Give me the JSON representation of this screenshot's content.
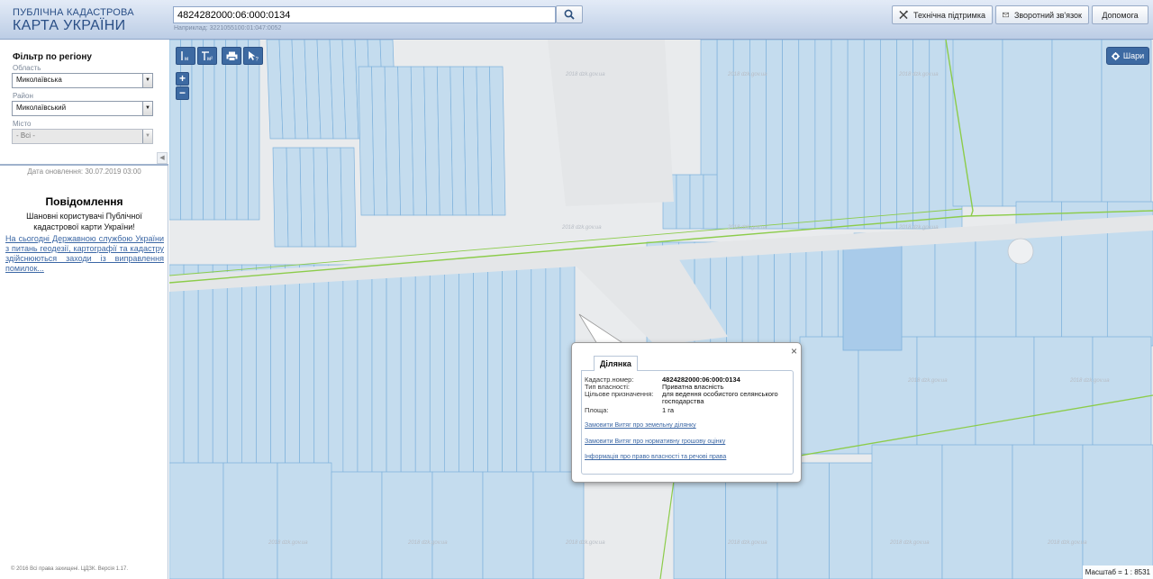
{
  "header": {
    "logo_line1": "ПУБЛІЧНА КАДАСТРОВА",
    "logo_line2": "КАРТА УКРАЇНИ",
    "search_value": "4824282000:06:000:0134",
    "search_hint": "Наприклад: 3221055100:01:047:0052",
    "buttons": {
      "support": "Технічна підтримка",
      "feedback": "Зворотний зв'язок",
      "help": "Допомога"
    }
  },
  "sidebar": {
    "filter_title": "Фільтр по регіону",
    "oblast_label": "Область",
    "oblast_value": "Миколаївська",
    "rayon_label": "Район",
    "rayon_value": "Миколаївський",
    "city_label": "Місто",
    "city_value": "- Всі -",
    "update_date": "Дата оновлення: 30.07.2019 03:00",
    "notice_title": "Повідомлення",
    "notice_text": "Шановні користувачі Публічної кадастрової карти України!",
    "notice_link": "На сьогодні Державною службою України з питань геодезії, картографії та кадастру здійснюються заходи із виправлення помилок...",
    "copyright": "© 2016 Всі права захищені. ЦДЗК. Версія 1.17."
  },
  "map": {
    "layers_label": "Шари",
    "scale_text": "Масштаб = 1 : 8531",
    "watermark": "2018 dzk.gov.ua"
  },
  "popup": {
    "tab_label": "Ділянка",
    "fields": [
      {
        "label": "Кадастр.номер:",
        "value": "4824282000:06:000:0134"
      },
      {
        "label": "Тип власності:",
        "value": "Приватна власність"
      },
      {
        "label": "Цільове призначення:",
        "value": "для ведення особистого селянського господарства"
      },
      {
        "label": "Площа:",
        "value": "1 га"
      }
    ],
    "links": [
      "Замовити Витяг про земельну ділянку",
      "Замовити Витяг про нормативну грошову оцінку",
      "Інформація про право власності та речові права"
    ]
  },
  "colors": {
    "parcel_fill": "#c4dcee",
    "parcel_stroke": "#7fb2dc",
    "road_line": "#8ccc4a",
    "map_bg": "#e9ebed",
    "header_text": "#2a4f86",
    "link": "#3b67a5",
    "toolbar_button": "#3d6aa2"
  }
}
